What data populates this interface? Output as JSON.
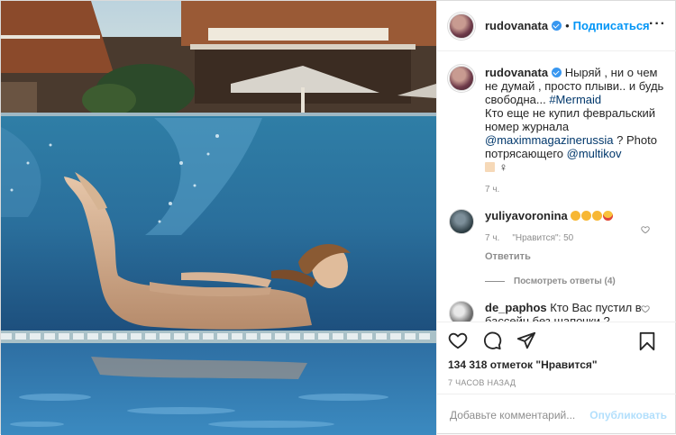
{
  "header": {
    "username": "rudovanata",
    "separator": "•",
    "follow_label": "Подписаться",
    "more_label": "···"
  },
  "caption": {
    "username": "rudovanata",
    "text_1": "Ныряй , ни о чем не думай , просто плыви.. и будь свободна... ",
    "hashtag": "#Mermaid",
    "text_2": "Кто еще не купил февральский номер журнала ",
    "mention_1": "@maximmagazinerussia",
    "text_3": " ? Photo потрясающего ",
    "mention_2": "@multikov",
    "female_sign": "♀",
    "time": "7 ч."
  },
  "comments": [
    {
      "username": "yuliyavoronina",
      "time": "7 ч.",
      "likes": "\"Нравится\": 50",
      "reply": "Ответить",
      "view_replies": "Посмотреть ответы (4)"
    },
    {
      "username": "de_paphos",
      "text": "Кто Вас пустил в бассейн без шапочки ?"
    }
  ],
  "actions": {
    "likes": "134 318 отметок \"Нравится\"",
    "timestamp": "7 ЧАСОВ НАЗАД"
  },
  "add_comment": {
    "placeholder": "Добавьте комментарий...",
    "publish": "Опубликовать"
  },
  "colors": {
    "accent": "#0095f6",
    "link": "#00376b",
    "muted": "#8e8e8e"
  }
}
